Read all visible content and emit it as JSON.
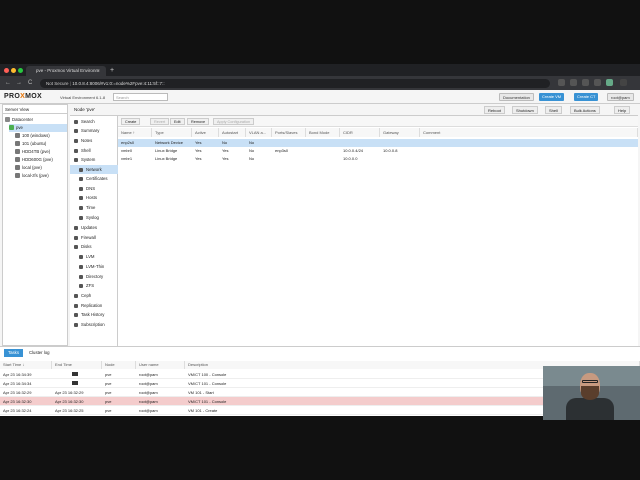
{
  "browser": {
    "tab_title": "pve - Proxmox Virtual Environm",
    "tab_close": "×",
    "new_tab": "+",
    "url_prefix": "Not Secure",
    "url": "10.0.8.4:8006/#v1:0:=node%2Fpve:4:11:5f::7::",
    "back": "←",
    "forward": "→",
    "reload": "C"
  },
  "header": {
    "logo_left": "PRO",
    "logo_x": "X",
    "logo_right": "MOX",
    "version": "Virtual Environment 6.1-8",
    "search_placeholder": "Search",
    "documentation": "Documentation",
    "create_vm": "Create VM",
    "create_ct": "Create CT",
    "user": "root@pam"
  },
  "tree": {
    "view": "Server View",
    "items": [
      {
        "label": "Datacenter",
        "color": "#888888"
      },
      {
        "label": "pve",
        "color": "#4caf50"
      },
      {
        "label": "100 (windows)",
        "color": "#777777"
      },
      {
        "label": "101 (ubuntu)",
        "color": "#777777"
      },
      {
        "label": "HDD4TB (pve)",
        "color": "#777777"
      },
      {
        "label": "HDD600G (pve)",
        "color": "#777777"
      },
      {
        "label": "local (pve)",
        "color": "#777777"
      },
      {
        "label": "local-zfs (pve)",
        "color": "#777777"
      }
    ]
  },
  "crumb": {
    "title": "Node 'pve'",
    "reboot": "Reboot",
    "shutdown": "Shutdown",
    "shell": "Shell",
    "bulk": "Bulk Actions",
    "help": "Help"
  },
  "menu": [
    {
      "label": "Search",
      "sub": false
    },
    {
      "label": "Summary",
      "sub": false
    },
    {
      "label": "Notes",
      "sub": false
    },
    {
      "label": "Shell",
      "sub": false
    },
    {
      "label": "System",
      "sub": false
    },
    {
      "label": "Network",
      "sub": true
    },
    {
      "label": "Certificates",
      "sub": true
    },
    {
      "label": "DNS",
      "sub": true
    },
    {
      "label": "Hosts",
      "sub": true
    },
    {
      "label": "Time",
      "sub": true
    },
    {
      "label": "Syslog",
      "sub": true
    },
    {
      "label": "Updates",
      "sub": false
    },
    {
      "label": "Firewall",
      "sub": false
    },
    {
      "label": "Disks",
      "sub": false
    },
    {
      "label": "LVM",
      "sub": true
    },
    {
      "label": "LVM-Thin",
      "sub": true
    },
    {
      "label": "Directory",
      "sub": true
    },
    {
      "label": "ZFS",
      "sub": true
    },
    {
      "label": "Ceph",
      "sub": false
    },
    {
      "label": "Replication",
      "sub": false
    },
    {
      "label": "Task History",
      "sub": false
    },
    {
      "label": "Subscription",
      "sub": false
    }
  ],
  "toolbar": {
    "create": "Create",
    "revert": "Revert",
    "edit": "Edit",
    "remove": "Remove",
    "apply": "Apply Configuration"
  },
  "network": {
    "columns": [
      "Name ↑",
      "Type",
      "Active",
      "Autostart",
      "VLAN a...",
      "Ports/Slaves",
      "Bond Mode",
      "CIDR",
      "Gateway",
      "Comment"
    ],
    "rows": [
      [
        "enp2s0",
        "Network Device",
        "Yes",
        "No",
        "No",
        "",
        "",
        "",
        "",
        ""
      ],
      [
        "vmbr0",
        "Linux Bridge",
        "Yes",
        "Yes",
        "No",
        "enp3s0",
        "",
        "10.0.0.4/24",
        "10.0.0.8",
        ""
      ],
      [
        "vmbr1",
        "Linux Bridge",
        "Yes",
        "Yes",
        "No",
        "",
        "",
        "10.0.0.0",
        "",
        ""
      ]
    ]
  },
  "tasks": {
    "tab_tasks": "Tasks",
    "tab_cluster": "Cluster log",
    "columns": [
      "Start Time ↓",
      "End Time",
      "Node",
      "User name",
      "Description"
    ],
    "rows": [
      [
        "Apr 23 16:34:39",
        "",
        "pve",
        "root@pam",
        "VM/CT 100 - Console"
      ],
      [
        "Apr 23 16:34:34",
        "",
        "pve",
        "root@pam",
        "VM/CT 101 - Console"
      ],
      [
        "Apr 23 16:32:29",
        "Apr 23 16:32:29",
        "pve",
        "root@pam",
        "VM 101 - Start"
      ],
      [
        "Apr 23 16:32:30",
        "Apr 23 16:32:30",
        "pve",
        "root@pam",
        "VM/CT 101 - Console"
      ],
      [
        "Apr 23 16:32:24",
        "Apr 23 16:32:25",
        "pve",
        "root@pam",
        "VM 101 - Create"
      ]
    ]
  }
}
